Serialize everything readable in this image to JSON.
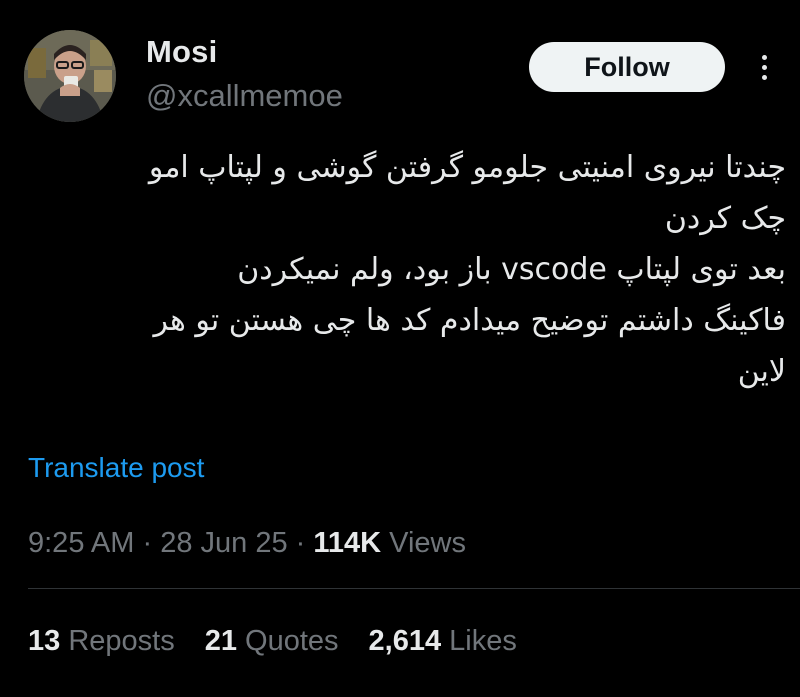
{
  "author": {
    "display_name": "Mosi",
    "handle": "@xcallmemoe",
    "avatar_icon": "user-avatar-photo"
  },
  "follow_label": "Follow",
  "more_icon": "more-vertical-icon",
  "text_lines": [
    "چندتا نیروی امنیتی جلومو گرفتن گوشی و لپتاپ امو",
    "چک کردن",
    "بعد توی لپتاپ vscode باز بود، ولم نمیکردن",
    "فاکینگ داشتم توضیح میدادم کد ها چی هستن تو هر",
    "لاین"
  ],
  "translate_label": "Translate post",
  "meta": {
    "time": "9:25 AM",
    "sep1": " · ",
    "date": "28 Jun 25",
    "sep2": " · ",
    "views_count": "114K",
    "views_label": " Views"
  },
  "stats": [
    {
      "count": "13",
      "label": " Reposts"
    },
    {
      "count": "21",
      "label": " Quotes"
    },
    {
      "count": "2,614",
      "label": " Likes"
    }
  ],
  "colors": {
    "background": "#000000",
    "text": "#e7e9ea",
    "secondary": "#71767b",
    "link": "#1d9bf0",
    "button_bg": "#eff3f4"
  }
}
